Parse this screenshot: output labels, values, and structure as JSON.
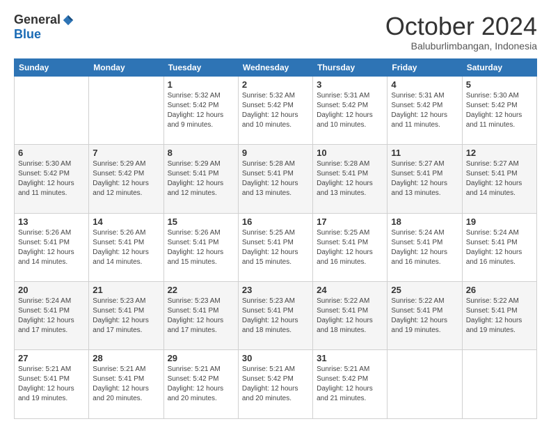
{
  "logo": {
    "general": "General",
    "blue": "Blue"
  },
  "header": {
    "month": "October 2024",
    "location": "Baluburlimbangan, Indonesia"
  },
  "weekdays": [
    "Sunday",
    "Monday",
    "Tuesday",
    "Wednesday",
    "Thursday",
    "Friday",
    "Saturday"
  ],
  "weeks": [
    [
      {
        "day": "",
        "info": ""
      },
      {
        "day": "",
        "info": ""
      },
      {
        "day": "1",
        "info": "Sunrise: 5:32 AM\nSunset: 5:42 PM\nDaylight: 12 hours and 9 minutes."
      },
      {
        "day": "2",
        "info": "Sunrise: 5:32 AM\nSunset: 5:42 PM\nDaylight: 12 hours and 10 minutes."
      },
      {
        "day": "3",
        "info": "Sunrise: 5:31 AM\nSunset: 5:42 PM\nDaylight: 12 hours and 10 minutes."
      },
      {
        "day": "4",
        "info": "Sunrise: 5:31 AM\nSunset: 5:42 PM\nDaylight: 12 hours and 11 minutes."
      },
      {
        "day": "5",
        "info": "Sunrise: 5:30 AM\nSunset: 5:42 PM\nDaylight: 12 hours and 11 minutes."
      }
    ],
    [
      {
        "day": "6",
        "info": "Sunrise: 5:30 AM\nSunset: 5:42 PM\nDaylight: 12 hours and 11 minutes."
      },
      {
        "day": "7",
        "info": "Sunrise: 5:29 AM\nSunset: 5:42 PM\nDaylight: 12 hours and 12 minutes."
      },
      {
        "day": "8",
        "info": "Sunrise: 5:29 AM\nSunset: 5:41 PM\nDaylight: 12 hours and 12 minutes."
      },
      {
        "day": "9",
        "info": "Sunrise: 5:28 AM\nSunset: 5:41 PM\nDaylight: 12 hours and 13 minutes."
      },
      {
        "day": "10",
        "info": "Sunrise: 5:28 AM\nSunset: 5:41 PM\nDaylight: 12 hours and 13 minutes."
      },
      {
        "day": "11",
        "info": "Sunrise: 5:27 AM\nSunset: 5:41 PM\nDaylight: 12 hours and 13 minutes."
      },
      {
        "day": "12",
        "info": "Sunrise: 5:27 AM\nSunset: 5:41 PM\nDaylight: 12 hours and 14 minutes."
      }
    ],
    [
      {
        "day": "13",
        "info": "Sunrise: 5:26 AM\nSunset: 5:41 PM\nDaylight: 12 hours and 14 minutes."
      },
      {
        "day": "14",
        "info": "Sunrise: 5:26 AM\nSunset: 5:41 PM\nDaylight: 12 hours and 14 minutes."
      },
      {
        "day": "15",
        "info": "Sunrise: 5:26 AM\nSunset: 5:41 PM\nDaylight: 12 hours and 15 minutes."
      },
      {
        "day": "16",
        "info": "Sunrise: 5:25 AM\nSunset: 5:41 PM\nDaylight: 12 hours and 15 minutes."
      },
      {
        "day": "17",
        "info": "Sunrise: 5:25 AM\nSunset: 5:41 PM\nDaylight: 12 hours and 16 minutes."
      },
      {
        "day": "18",
        "info": "Sunrise: 5:24 AM\nSunset: 5:41 PM\nDaylight: 12 hours and 16 minutes."
      },
      {
        "day": "19",
        "info": "Sunrise: 5:24 AM\nSunset: 5:41 PM\nDaylight: 12 hours and 16 minutes."
      }
    ],
    [
      {
        "day": "20",
        "info": "Sunrise: 5:24 AM\nSunset: 5:41 PM\nDaylight: 12 hours and 17 minutes."
      },
      {
        "day": "21",
        "info": "Sunrise: 5:23 AM\nSunset: 5:41 PM\nDaylight: 12 hours and 17 minutes."
      },
      {
        "day": "22",
        "info": "Sunrise: 5:23 AM\nSunset: 5:41 PM\nDaylight: 12 hours and 17 minutes."
      },
      {
        "day": "23",
        "info": "Sunrise: 5:23 AM\nSunset: 5:41 PM\nDaylight: 12 hours and 18 minutes."
      },
      {
        "day": "24",
        "info": "Sunrise: 5:22 AM\nSunset: 5:41 PM\nDaylight: 12 hours and 18 minutes."
      },
      {
        "day": "25",
        "info": "Sunrise: 5:22 AM\nSunset: 5:41 PM\nDaylight: 12 hours and 19 minutes."
      },
      {
        "day": "26",
        "info": "Sunrise: 5:22 AM\nSunset: 5:41 PM\nDaylight: 12 hours and 19 minutes."
      }
    ],
    [
      {
        "day": "27",
        "info": "Sunrise: 5:21 AM\nSunset: 5:41 PM\nDaylight: 12 hours and 19 minutes."
      },
      {
        "day": "28",
        "info": "Sunrise: 5:21 AM\nSunset: 5:41 PM\nDaylight: 12 hours and 20 minutes."
      },
      {
        "day": "29",
        "info": "Sunrise: 5:21 AM\nSunset: 5:42 PM\nDaylight: 12 hours and 20 minutes."
      },
      {
        "day": "30",
        "info": "Sunrise: 5:21 AM\nSunset: 5:42 PM\nDaylight: 12 hours and 20 minutes."
      },
      {
        "day": "31",
        "info": "Sunrise: 5:21 AM\nSunset: 5:42 PM\nDaylight: 12 hours and 21 minutes."
      },
      {
        "day": "",
        "info": ""
      },
      {
        "day": "",
        "info": ""
      }
    ]
  ]
}
